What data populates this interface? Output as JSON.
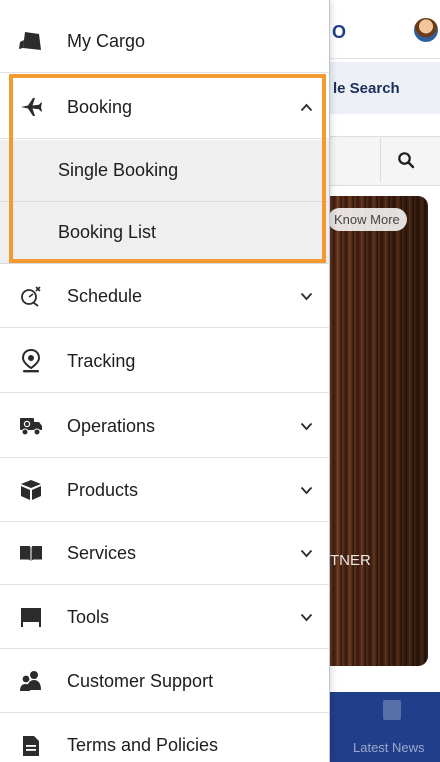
{
  "background": {
    "logo_fragment": "O",
    "search_tab_label": "le Search",
    "know_more_label": "Know More",
    "banner_text": "TNER",
    "bottom_nav_label": "Latest News"
  },
  "menu": {
    "items": [
      {
        "label": "My Cargo",
        "icon": "cargo-icon"
      },
      {
        "label": "Booking",
        "icon": "airplane-icon",
        "expanded": true,
        "children": [
          {
            "label": "Single Booking"
          },
          {
            "label": "Booking List"
          }
        ]
      },
      {
        "label": "Schedule",
        "icon": "schedule-icon"
      },
      {
        "label": "Tracking",
        "icon": "location-pin-icon"
      },
      {
        "label": "Operations",
        "icon": "truck-icon"
      },
      {
        "label": "Products",
        "icon": "box-icon"
      },
      {
        "label": "Services",
        "icon": "book-icon"
      },
      {
        "label": "Tools",
        "icon": "tools-icon"
      },
      {
        "label": "Customer Support",
        "icon": "people-icon"
      },
      {
        "label": "Terms and Policies",
        "icon": "document-icon"
      }
    ]
  },
  "colors": {
    "highlight": "#f39a32",
    "icon": "#2c2c2c",
    "brand_blue": "#213e8a"
  }
}
